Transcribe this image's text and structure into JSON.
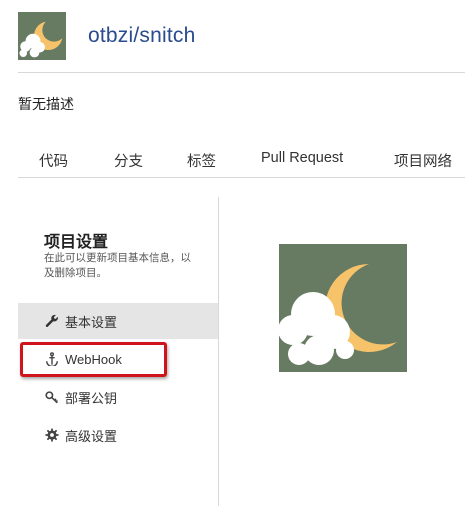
{
  "repo": {
    "title": "otbzi/snitch",
    "description": "暂无描述"
  },
  "tabs": [
    {
      "label": "代码"
    },
    {
      "label": "分支"
    },
    {
      "label": "标签"
    },
    {
      "label": "Pull Request"
    },
    {
      "label": "项目网络"
    }
  ],
  "settings": {
    "title": "项目设置",
    "hint": "在此可以更新项目基本信息，以及删除项目。",
    "menu": [
      {
        "label": "基本设置",
        "icon": "wrench-icon",
        "active": true
      },
      {
        "label": "WebHook",
        "icon": "anchor-icon",
        "active": false
      },
      {
        "label": "部署公钥",
        "icon": "key-icon",
        "active": false
      },
      {
        "label": "高级设置",
        "icon": "gear-icon",
        "active": false
      }
    ]
  },
  "colors": {
    "avatar_bg": "#677a62",
    "moon": "#f7c36a",
    "cloud": "#ffffff",
    "highlight": "#d0141c",
    "link": "#2a4b8d"
  }
}
